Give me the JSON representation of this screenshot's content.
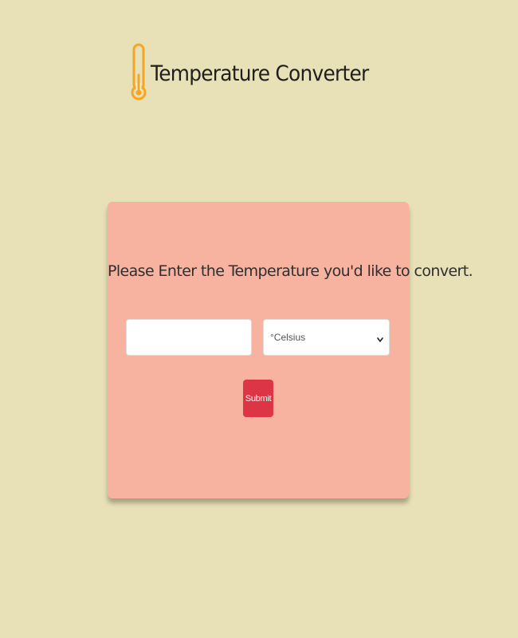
{
  "app": {
    "title": "Temperature Converter",
    "logo_icon": "thermometer-icon"
  },
  "form": {
    "prompt": "Please Enter the Temperature you'd like to convert.",
    "temperature_input": {
      "value": "",
      "placeholder": ""
    },
    "unit_select": {
      "selected": "°Celsius"
    },
    "submit_label": "Submit"
  },
  "colors": {
    "page_background": "#e8e0b6",
    "card_background": "#f8b2a0",
    "accent_logo": "#f5a623",
    "submit_button": "#dc3545"
  }
}
